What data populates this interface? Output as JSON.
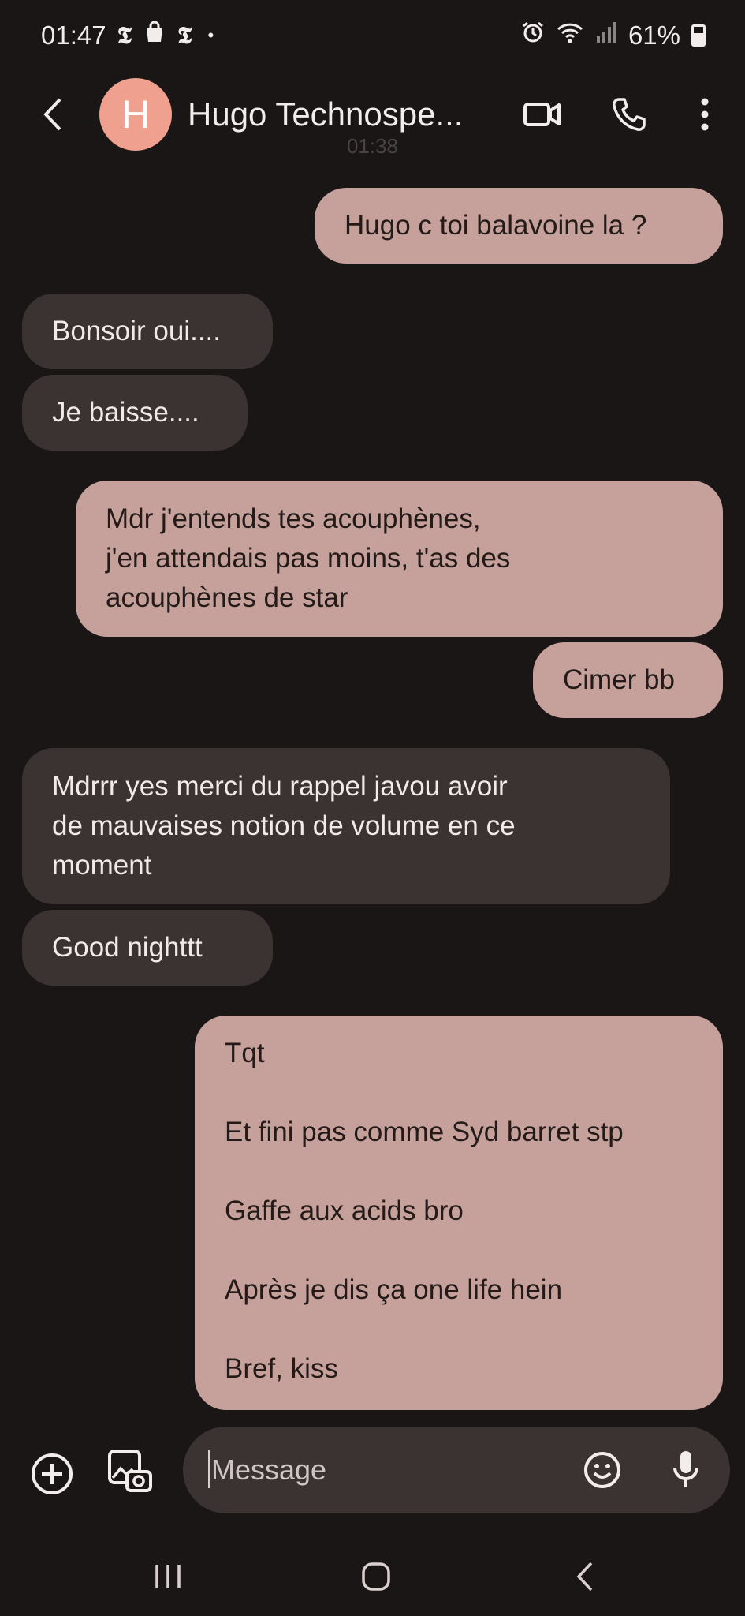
{
  "status_bar": {
    "time": "01:47",
    "notification_icons": [
      "nyt-icon",
      "shopping-bag-icon",
      "nyt-icon",
      "dot-icon"
    ],
    "nyt_glyph": "𝕿",
    "dot_glyph": "•",
    "battery_percent": "61%",
    "battery_level": 0.61
  },
  "header": {
    "avatar_initial": "H",
    "avatar_color": "#f0a08e",
    "contact_name": "Hugo Technospe...",
    "timestamp_behind": "01:38"
  },
  "messages": [
    {
      "direction": "sent",
      "lines": [
        "Hugo c toi balavoine la ?"
      ]
    },
    {
      "direction": "received",
      "lines": [
        "Bonsoir oui...."
      ]
    },
    {
      "direction": "received",
      "lines": [
        "Je baisse...."
      ]
    },
    {
      "direction": "sent",
      "lines": [
        "Mdr j'entends tes acouphènes,",
        "j'en attendais pas moins, t'as des",
        "acouphènes de star"
      ]
    },
    {
      "direction": "sent",
      "lines": [
        "Cimer bb"
      ]
    },
    {
      "direction": "received",
      "lines": [
        "Mdrrr yes merci du rappel javou avoir",
        "de mauvaises notion de volume en ce",
        "moment"
      ]
    },
    {
      "direction": "received",
      "lines": [
        "Good nighttt"
      ]
    },
    {
      "direction": "sent",
      "paragraphs": [
        "Tqt",
        "Et fini pas comme Syd barret stp",
        "Gaffe aux acids bro",
        "Après je dis ça one life hein",
        "Bref, kiss"
      ]
    }
  ],
  "composer": {
    "placeholder": "Message",
    "value": ""
  },
  "colors": {
    "background": "#1a1615",
    "sent_bubble": "#c6a19b",
    "received_bubble": "#3a3332"
  }
}
